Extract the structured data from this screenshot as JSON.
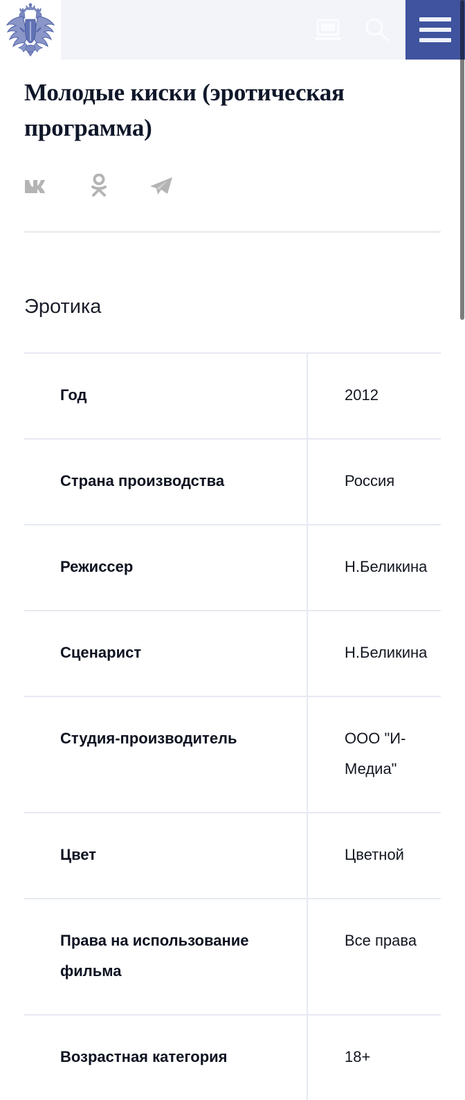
{
  "header": {
    "logo_alt": "Государственный герб Российской Федерации",
    "icons": [
      {
        "name": "laptop-icon",
        "label": "Версия для слабовидящих"
      },
      {
        "name": "search-icon",
        "label": "Поиск"
      }
    ],
    "menu_label": "Меню"
  },
  "page": {
    "title": "Молодые киски (эротическая программа)",
    "section_title": "Эротика"
  },
  "share": {
    "items": [
      {
        "name": "vk-icon",
        "label": "ВКонтакте"
      },
      {
        "name": "odnoklassniki-icon",
        "label": "Одноклассники"
      },
      {
        "name": "telegram-icon",
        "label": "Telegram"
      }
    ]
  },
  "info_table": {
    "rows": [
      {
        "label": "Год",
        "value": "2012"
      },
      {
        "label": "Страна производства",
        "value": "Россия"
      },
      {
        "label": "Режиссер",
        "value": "Н.Беликина"
      },
      {
        "label": "Сценарист",
        "value": "Н.Беликина"
      },
      {
        "label": "Студия-производитель",
        "value": "ООО \"И-Медиа\""
      },
      {
        "label": "Цвет",
        "value": "Цветной"
      },
      {
        "label": "Права на использование фильма",
        "value": "Все права"
      },
      {
        "label": "Возрастная категория",
        "value": "18+"
      }
    ]
  },
  "colors": {
    "brand_blue": "#3f539e",
    "header_panel": "#f2f4f9",
    "divider": "#e6e9f1",
    "title_text": "#0f1729"
  }
}
